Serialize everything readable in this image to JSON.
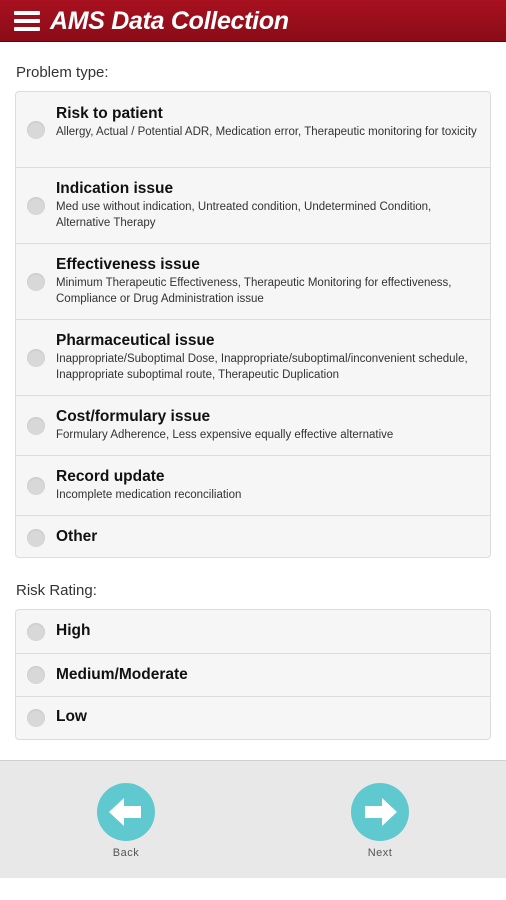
{
  "header": {
    "title": "AMS Data Collection",
    "menu_icon": "hamburger-icon"
  },
  "problem_type": {
    "label": "Problem type:",
    "options": [
      {
        "title": "Risk to patient",
        "desc": "Allergy, Actual / Potential ADR, Medication error, Therapeutic monitoring for toxicity"
      },
      {
        "title": "Indication issue",
        "desc": "Med use without indication, Untreated condition, Undetermined Condition, Alternative Therapy"
      },
      {
        "title": "Effectiveness issue",
        "desc": "Minimum Therapeutic Effectiveness, Therapeutic Monitoring for effectiveness, Compliance or Drug Administration issue"
      },
      {
        "title": "Pharmaceutical issue",
        "desc": "Inappropriate/Suboptimal Dose, Inappropriate/suboptimal/inconvenient schedule, Inappropriate suboptimal route, Therapeutic Duplication"
      },
      {
        "title": "Cost/formulary issue",
        "desc": "Formulary Adherence, Less expensive equally effective alternative"
      },
      {
        "title": "Record update",
        "desc": "Incomplete medication reconciliation"
      },
      {
        "title": "Other",
        "desc": ""
      }
    ]
  },
  "risk_rating": {
    "label": "Risk Rating:",
    "options": [
      {
        "title": "High"
      },
      {
        "title": "Medium/Moderate"
      },
      {
        "title": "Low"
      }
    ]
  },
  "footer": {
    "back_label": "Back",
    "next_label": "Next",
    "button_color": "#5fc9cf"
  },
  "colors": {
    "header": "#9b0f1c",
    "radio": "#d8d8d8"
  }
}
